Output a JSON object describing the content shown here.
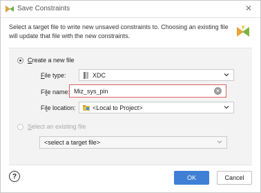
{
  "window": {
    "title": "Save Constraints"
  },
  "description": "Select a target file to write new unsaved constraints to. Choosing an existing file will update that file with the new constraints.",
  "options": {
    "create_new": {
      "label_mnemonic": "C",
      "label_rest": "reate a new file",
      "selected": true
    },
    "file_type": {
      "label_mnemonic": "F",
      "label_rest": "ile type:",
      "value": "XDC",
      "icon": "xdc-file-icon"
    },
    "file_name": {
      "label_pre": "Fi",
      "label_mnemonic": "l",
      "label_rest": "e name:",
      "value": "Miz_sys_pin"
    },
    "file_location": {
      "label_pre": "Fi",
      "label_mnemonic": "l",
      "label_rest": "e location:",
      "value": "<Local to Project>",
      "icon": "folder-icon"
    },
    "select_existing": {
      "label_mnemonic": "S",
      "label_rest": "elect an existing file",
      "selected": false,
      "placeholder": "<select a target file>"
    }
  },
  "buttons": {
    "help": "?",
    "ok": "OK",
    "cancel": "Cancel"
  },
  "colors": {
    "accent": "#3f7fd6",
    "error_border": "#e06060"
  }
}
